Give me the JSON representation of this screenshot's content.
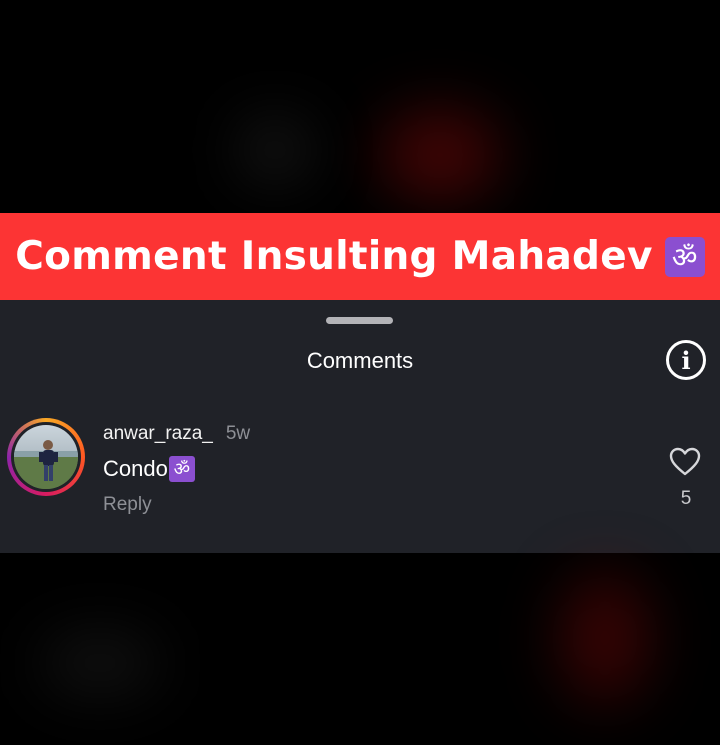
{
  "banner": {
    "title": "Comment Insulting Mahadev",
    "emoji": "ॐ"
  },
  "sheet": {
    "title": "Comments",
    "info_icon": "info-icon",
    "info_glyph": "i"
  },
  "comment": {
    "username": "anwar_raza_",
    "timestamp": "5w",
    "text": "Condo",
    "emoji": "ॐ",
    "reply_label": "Reply",
    "like_icon": "heart-icon",
    "like_count": "5"
  },
  "colors": {
    "banner_bg": "#fc3434",
    "sheet_bg": "#202228",
    "om_badge": "#8b4fd0",
    "muted_text": "#8e9096"
  }
}
